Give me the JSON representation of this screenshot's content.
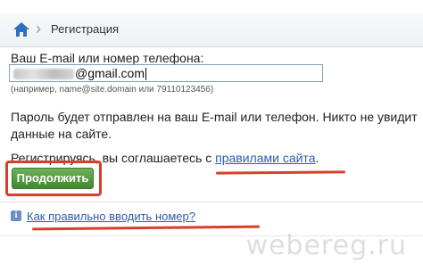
{
  "breadcrumb": {
    "home_icon": "home-icon",
    "separator": "›",
    "current": "Регистрация"
  },
  "form": {
    "email_label": "Ваш E-mail или номер телефона:",
    "email_value_visible": "@gmail.com",
    "email_hint": "(например, name@site.domain или 79110123456)",
    "info_line_1": "Пароль будет отправлен на ваш E-mail или телефон. Никто не увидит",
    "info_line_2": "данные на сайте.",
    "agree_prefix": "Регистрируясь, вы соглашаетесь с ",
    "agree_link": "правилами сайта",
    "agree_suffix": ".",
    "continue_label": "Продолжить"
  },
  "help": {
    "icon": "info-icon",
    "link": "Как правильно вводить номер?"
  },
  "watermark": "webereg.ru",
  "colors": {
    "link": "#2a5db0",
    "button": "#4f9a3c",
    "annotation": "#d6402a"
  }
}
